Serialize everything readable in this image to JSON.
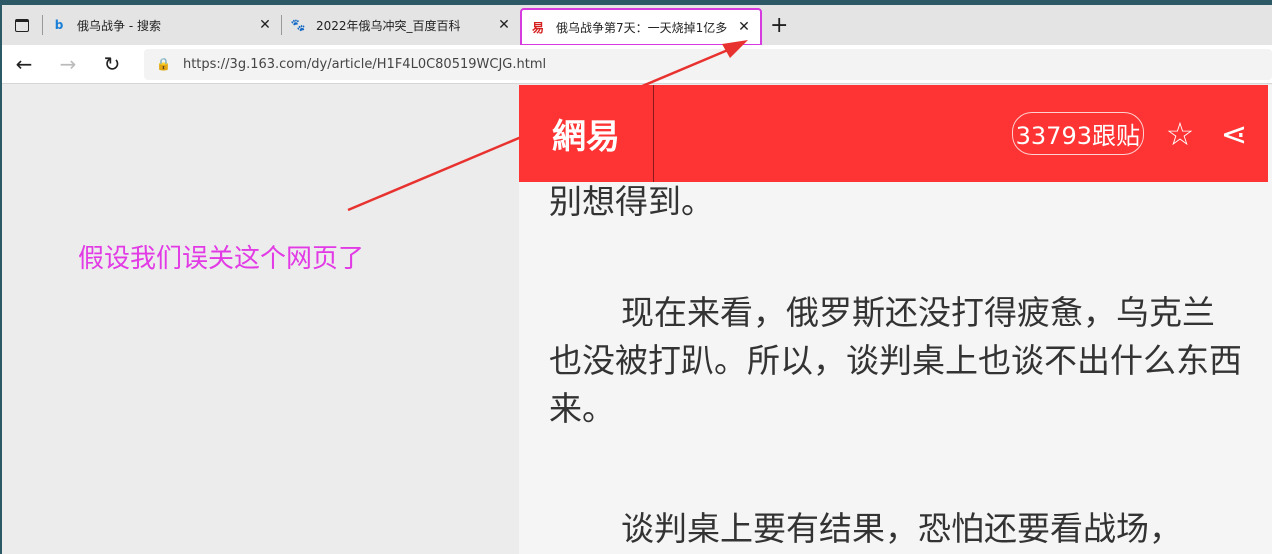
{
  "tabs": [
    {
      "title": "俄乌战争 - 搜索",
      "icon": "bing-icon"
    },
    {
      "title": "2022年俄乌冲突_百度百科",
      "icon": "baidu-icon"
    },
    {
      "title": "俄乌战争第7天：一天烧掉1亿多",
      "icon": "netease-icon",
      "active": true
    }
  ],
  "address": {
    "url": "https://3g.163.com/dy/article/H1F4L0C80519WCJG.html"
  },
  "site": {
    "logo": "網易",
    "comments": "33793跟贴",
    "brand_color": "#fe3333"
  },
  "article": {
    "paragraphs": [
      "别想得到。",
      "现在来看，俄罗斯还没打得疲惫，乌克兰也没被打趴。所以，谈判桌上也谈不出什么东西来。",
      "谈判桌上要有结果，恐怕还要看战场，"
    ]
  },
  "annotation": {
    "text": "假设我们误关这个网页了",
    "color": "#e23be6"
  }
}
